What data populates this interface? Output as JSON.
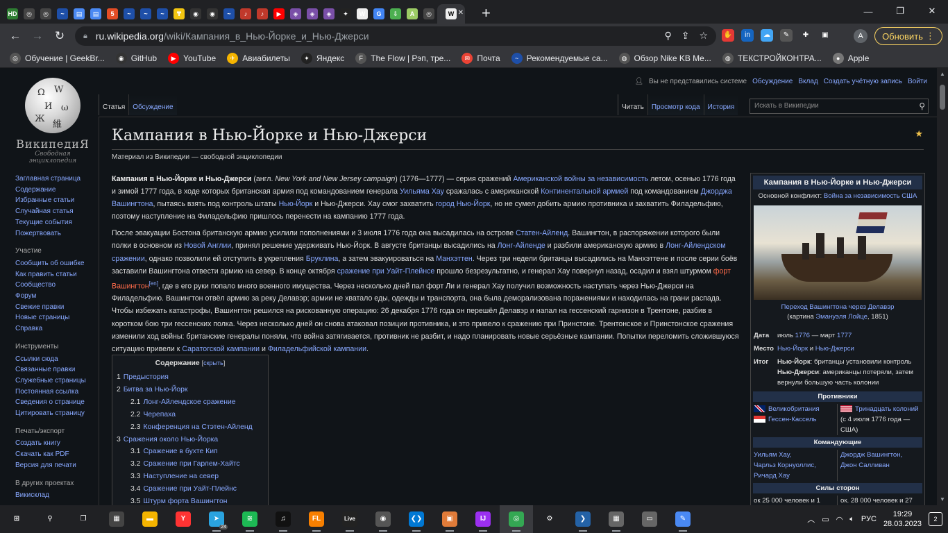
{
  "browser": {
    "tabs": [
      {
        "icon": "hd-icon",
        "glyph": "HD",
        "color": "#2e7d32"
      },
      {
        "icon": "openai-icon",
        "glyph": "◎",
        "color": "#444"
      },
      {
        "icon": "openai-icon",
        "glyph": "◎",
        "color": "#444"
      },
      {
        "icon": "wave-icon",
        "glyph": "~",
        "color": "#1e4fa8"
      },
      {
        "icon": "doc-icon",
        "glyph": "▤",
        "color": "#4a89f3"
      },
      {
        "icon": "doc-icon",
        "glyph": "▤",
        "color": "#4a89f3"
      },
      {
        "icon": "html5-icon",
        "glyph": "5",
        "color": "#e44d26"
      },
      {
        "icon": "wave-icon",
        "glyph": "~",
        "color": "#1e4fa8"
      },
      {
        "icon": "wave-icon",
        "glyph": "~",
        "color": "#1e4fa8"
      },
      {
        "icon": "wave-icon",
        "glyph": "~",
        "color": "#1e4fa8"
      },
      {
        "icon": "coin-icon",
        "glyph": "₸",
        "color": "#f2c511"
      },
      {
        "icon": "github-icon",
        "glyph": "◉",
        "color": "#333"
      },
      {
        "icon": "github-icon",
        "glyph": "◉",
        "color": "#333"
      },
      {
        "icon": "wave-icon",
        "glyph": "~",
        "color": "#1e4fa8"
      },
      {
        "icon": "apple-music-icon",
        "glyph": "♪",
        "color": "#c0392b"
      },
      {
        "icon": "apple-music-icon",
        "glyph": "♪",
        "color": "#c0392b"
      },
      {
        "icon": "youtube-icon",
        "glyph": "▶",
        "color": "#ff0000"
      },
      {
        "icon": "shield-icon",
        "glyph": "◈",
        "color": "#7a4fa8"
      },
      {
        "icon": "shield-icon",
        "glyph": "◈",
        "color": "#7a4fa8"
      },
      {
        "icon": "shield-icon",
        "glyph": "◈",
        "color": "#7a4fa8"
      },
      {
        "icon": "star-icon",
        "glyph": "✦",
        "color": "#222"
      },
      {
        "icon": "wikipedia-icon",
        "glyph": "W",
        "color": "#eee"
      },
      {
        "icon": "google-icon",
        "glyph": "G",
        "color": "#4285f4"
      },
      {
        "icon": "download-icon",
        "glyph": "⇩",
        "color": "#4caf50"
      },
      {
        "icon": "a-icon",
        "glyph": "A",
        "color": "#9ccc65"
      },
      {
        "icon": "openai-icon",
        "glyph": "◎",
        "color": "#444"
      }
    ],
    "active_tab": {
      "icon": "wikipedia-icon",
      "glyph": "W"
    },
    "url_host": "ru.wikipedia.org",
    "url_path": "/wiki/Кампания_в_Нью-Йорке_и_Нью-Джерси",
    "update_label": "Обновить",
    "avatar_letter": "A",
    "extensions": [
      {
        "icon": "adblock-icon",
        "glyph": "✋",
        "color": "#e53935"
      },
      {
        "icon": "vk-icon",
        "glyph": "in",
        "color": "#1565c0"
      },
      {
        "icon": "cloud-icon",
        "glyph": "☁",
        "color": "#42a5f5"
      },
      {
        "icon": "pen-icon",
        "glyph": "✎",
        "color": "#555"
      },
      {
        "icon": "puzzle-icon",
        "glyph": "✚",
        "color": "#35363a"
      },
      {
        "icon": "sidepanel-icon",
        "glyph": "▣",
        "color": "#35363a"
      }
    ]
  },
  "bookmarks": [
    {
      "icon": "openai-icon",
      "glyph": "◎",
      "color": "#555",
      "label": "Обучение | GeekBr..."
    },
    {
      "icon": "github-icon",
      "glyph": "◉",
      "color": "#333",
      "label": "GitHub"
    },
    {
      "icon": "youtube-icon",
      "glyph": "▶",
      "color": "#ff0000",
      "label": "YouTube"
    },
    {
      "icon": "plane-icon",
      "glyph": "✈",
      "color": "#f5b400",
      "label": "Авиабилеты"
    },
    {
      "icon": "star-icon",
      "glyph": "✦",
      "color": "#222",
      "label": "Яндекс"
    },
    {
      "icon": "flow-icon",
      "glyph": "F",
      "color": "#555",
      "label": "The Flow | Рэп, тре..."
    },
    {
      "icon": "mail-icon",
      "glyph": "✉",
      "color": "#ea4335",
      "label": "Почта"
    },
    {
      "icon": "wave-icon",
      "glyph": "~",
      "color": "#1e4fa8",
      "label": "Рекомендуемые са..."
    },
    {
      "icon": "globe-icon",
      "glyph": "◍",
      "color": "#555",
      "label": "Обзор Nike KB Me..."
    },
    {
      "icon": "globe-icon",
      "glyph": "◍",
      "color": "#555",
      "label": "ТЕКСТРОЙКОНТРА..."
    },
    {
      "icon": "apple-icon",
      "glyph": "●",
      "color": "#777",
      "label": "Apple"
    }
  ],
  "wiki": {
    "logo_wordmark": "ВикипедиЯ",
    "logo_tagline": "Свободная энциклопедия",
    "personal": {
      "not_logged": "Вы не представились системе",
      "links": [
        "Обсуждение",
        "Вклад",
        "Создать учётную запись",
        "Войти"
      ]
    },
    "tabs_left": [
      "Статья",
      "Обсуждение"
    ],
    "tabs_right": [
      "Читать",
      "Просмотр кода",
      "История"
    ],
    "search_placeholder": "Искать в Википедии",
    "sidebar": {
      "main": [
        "Заглавная страница",
        "Содержание",
        "Избранные статьи",
        "Случайная статья",
        "Текущие события",
        "Пожертвовать"
      ],
      "participation_title": "Участие",
      "participation": [
        "Сообщить об ошибке",
        "Как править статьи",
        "Сообщество",
        "Форум",
        "Свежие правки",
        "Новые страницы",
        "Справка"
      ],
      "tools_title": "Инструменты",
      "tools": [
        "Ссылки сюда",
        "Связанные правки",
        "Служебные страницы",
        "Постоянная ссылка",
        "Сведения о странице",
        "Цитировать страницу"
      ],
      "print_title": "Печать/экспорт",
      "print": [
        "Создать книгу",
        "Скачать как PDF",
        "Версия для печати"
      ],
      "other_title": "В других проектах",
      "other": [
        "Викисклад"
      ]
    },
    "title": "Кампания в Нью-Йорке и Нью-Джерси",
    "sitesub": "Материал из Википедии — свободной энциклопедии",
    "toc": {
      "title": "Содержание",
      "toggle": "скрыть",
      "items": [
        {
          "num": "1",
          "text": "Предыстория",
          "level": 1
        },
        {
          "num": "2",
          "text": "Битва за Нью-Йорк",
          "level": 1
        },
        {
          "num": "2.1",
          "text": "Лонг-Айлендское сражение",
          "level": 2
        },
        {
          "num": "2.2",
          "text": "Черепаха",
          "level": 2
        },
        {
          "num": "2.3",
          "text": "Конференция на Стэтен-Айленд",
          "level": 2
        },
        {
          "num": "3",
          "text": "Сражения около Нью-Йорка",
          "level": 1
        },
        {
          "num": "3.1",
          "text": "Сражение в бухте Кип",
          "level": 2
        },
        {
          "num": "3.2",
          "text": "Сражение при Гарлем-Хайтс",
          "level": 2
        },
        {
          "num": "3.3",
          "text": "Наступление на север",
          "level": 2
        },
        {
          "num": "3.4",
          "text": "Сражение при Уайт-Плейнс",
          "level": 2
        },
        {
          "num": "3.5",
          "text": "Штурм форта Вашингтон",
          "level": 2
        }
      ]
    },
    "infobox": {
      "title": "Кампания в Нью-Йорке и Нью-Джерси",
      "conflict_label": "Основной конфликт:",
      "conflict_link": "Война за независимость США",
      "caption_link": "Переход Вашингтона через Делавэр",
      "caption_prefix": "(картина ",
      "caption_painter": "Эмануэля Лойце",
      "caption_suffix": ", 1851)",
      "date_label": "Дата",
      "date_pre": "июль ",
      "date_y1": "1776",
      "date_mid": " — март ",
      "date_y2": "1777",
      "place_label": "Место",
      "place_a": "Нью-Йорк",
      "place_and": " и ",
      "place_b": "Нью-Джерси",
      "result_label": "Итог",
      "result_1b": "Нью-Йорк",
      "result_1": ": британцы установили контроль",
      "result_2b": "Нью-Джерси",
      "result_2": ": американцы потеряли, затем вернули большую часть колонии",
      "opponents_head": "Противники",
      "opp_left": [
        "Великобритания",
        "Гессен-Кассель"
      ],
      "opp_right_link": "Тринадцать колоний",
      "opp_right_note": " (с 4 июля 1776 года — США)",
      "commanders_head": "Командующие",
      "cmd_left": [
        "Уильям Хау,",
        "Чарльз Корнуоллис,",
        "Ричард Хау"
      ],
      "cmd_right": [
        "Джордж Вашингтон,",
        "Джон Салливан"
      ],
      "forces_head": "Силы сторон",
      "forces_left": "ок 25 000 человек и 1",
      "forces_right": "ок. 28 000 человек и 27"
    }
  },
  "taskbar": {
    "apps": [
      {
        "icon": "windows-start-icon",
        "glyph": "⊞",
        "color": "transparent"
      },
      {
        "icon": "search-icon",
        "glyph": "⚲",
        "color": "transparent"
      },
      {
        "icon": "task-view-icon",
        "glyph": "❐",
        "color": "transparent"
      },
      {
        "icon": "calculator-icon",
        "glyph": "▦",
        "color": "#444"
      },
      {
        "icon": "file-explorer-icon",
        "glyph": "▬",
        "color": "#f4b400"
      },
      {
        "icon": "yandex-browser-icon",
        "glyph": "Y",
        "color": "#ff3333"
      },
      {
        "icon": "telegram-icon",
        "glyph": "➤",
        "color": "#2aa3df",
        "badge": "24"
      },
      {
        "icon": "spotify-icon",
        "glyph": "≋",
        "color": "#1db954"
      },
      {
        "icon": "music-icon",
        "glyph": "♫",
        "color": "#111"
      },
      {
        "icon": "fl-studio-icon",
        "glyph": "FL",
        "color": "#f77f00"
      },
      {
        "icon": "ableton-live-icon",
        "glyph": "Live",
        "color": "#222"
      },
      {
        "icon": "media-player-icon",
        "glyph": "◉",
        "color": "#555"
      },
      {
        "icon": "vscode-icon",
        "glyph": "❮❯",
        "color": "#0078d4"
      },
      {
        "icon": "box-icon",
        "glyph": "▣",
        "color": "#e07b39"
      },
      {
        "icon": "intellij-icon",
        "glyph": "IJ",
        "color": "#9b2ff0"
      },
      {
        "icon": "chrome-icon",
        "glyph": "◎",
        "color": "#34a853"
      },
      {
        "icon": "settings-icon",
        "glyph": "⚙",
        "color": "transparent"
      },
      {
        "icon": "powershell-icon",
        "glyph": "❯",
        "color": "#2462a6"
      },
      {
        "icon": "virtual-machine-icon",
        "glyph": "▦",
        "color": "#666"
      },
      {
        "icon": "monitor-icon",
        "glyph": "▭",
        "color": "#666"
      },
      {
        "icon": "paint-icon",
        "glyph": "✎",
        "color": "#4a89f3"
      }
    ],
    "lang": "РУС",
    "time": "19:29",
    "date": "28.03.2023",
    "notifications": "2"
  }
}
